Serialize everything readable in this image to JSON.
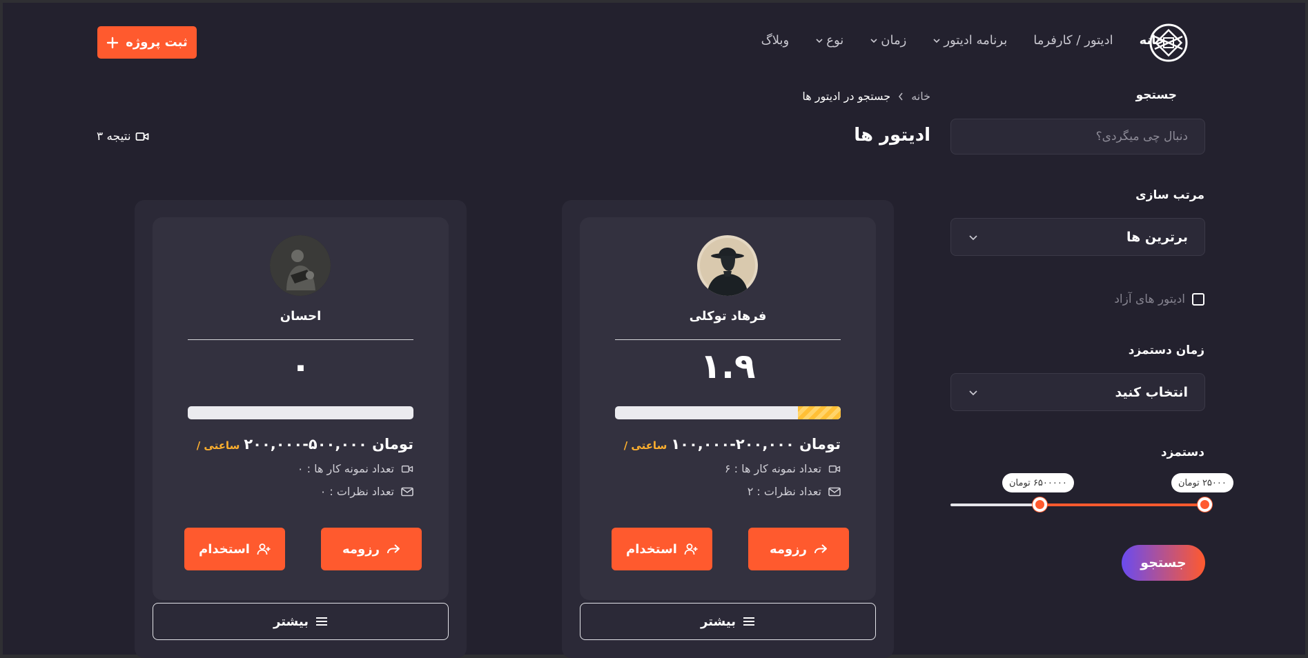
{
  "header": {
    "nav": {
      "home": "خانه",
      "editor_client": "ادیتور / کارفرما",
      "editing_app": "برنامه ادیتور",
      "time": "زمان",
      "type": "نوع",
      "blog": "وبلاگ"
    },
    "submit_project_label": "ثبت پروژه"
  },
  "breadcrumb": {
    "home": "خانه",
    "current": "جستجو در ادیتور ها"
  },
  "page_title": "ادیتور ها",
  "result_count": "۳ نتیجه",
  "sidebar": {
    "search_label": "جستجو",
    "search_placeholder": "دنبال چی میگردی؟",
    "sort_label": "مرتب سازی",
    "sort_value": "برترین ها",
    "freelance_label": "ادیتور های آزاد",
    "freelance_checked": false,
    "delivery_label": "زمان دستمزد",
    "delivery_value": "انتخاب کنید",
    "wage_label": "دستمزد",
    "range_min": "۲۵۰۰۰ تومان",
    "range_max": "۶۵۰۰۰۰۰ تومان",
    "search_button": "جستجو"
  },
  "cards": [
    {
      "name": "فرهاد توکلی",
      "score": "۱.۹",
      "rating_fraction": 0.19,
      "price": "۱۰۰,۰۰۰-۲۰۰,۰۰۰ تومان",
      "unit": "/ ساعتی",
      "samples": "تعداد نمونه کار ها : ۶",
      "reviews": "تعداد نظرات : ۲",
      "resume": "رزومه",
      "hire": "استخدام",
      "more": "بیشتر"
    },
    {
      "name": "احسان",
      "score": "۰",
      "rating_fraction": 0,
      "price": "۲۰۰,۰۰۰-۵۰۰,۰۰۰ تومان",
      "unit": "/ ساعتی",
      "samples": "تعداد نمونه کار ها : ۰",
      "reviews": "تعداد نظرات : ۰",
      "resume": "رزومه",
      "hire": "استخدام",
      "more": "بیشتر"
    }
  ],
  "colors": {
    "accent": "#ff5a2e",
    "rating": "#ffbf35",
    "background": "#23212e"
  }
}
